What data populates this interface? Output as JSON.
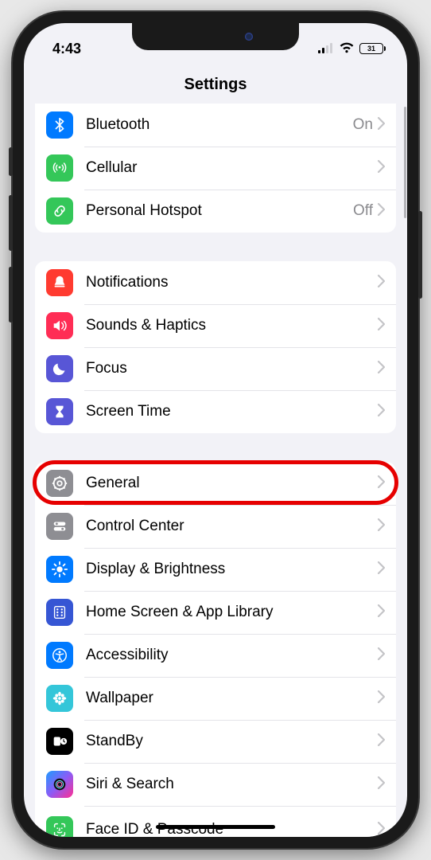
{
  "statusbar": {
    "time": "4:43",
    "battery_pct": "31"
  },
  "nav": {
    "title": "Settings"
  },
  "group0": {
    "bluetooth": {
      "label": "Bluetooth",
      "value": "On",
      "icon_color": "#007aff"
    },
    "cellular": {
      "label": "Cellular",
      "icon_color": "#34c759"
    },
    "hotspot": {
      "label": "Personal Hotspot",
      "value": "Off",
      "icon_color": "#34c759"
    }
  },
  "group1": {
    "notifications": {
      "label": "Notifications",
      "icon_color": "#ff3b30"
    },
    "sounds": {
      "label": "Sounds & Haptics",
      "icon_color": "#ff2d55"
    },
    "focus": {
      "label": "Focus",
      "icon_color": "#5856d6"
    },
    "screentime": {
      "label": "Screen Time",
      "icon_color": "#5856d6"
    }
  },
  "group2": {
    "general": {
      "label": "General",
      "icon_color": "#8e8e93"
    },
    "controlcenter": {
      "label": "Control Center",
      "icon_color": "#8e8e93"
    },
    "display": {
      "label": "Display & Brightness",
      "icon_color": "#007aff"
    },
    "homescreen": {
      "label": "Home Screen & App Library",
      "icon_color": "#3656d4"
    },
    "accessibility": {
      "label": "Accessibility",
      "icon_color": "#007aff"
    },
    "wallpaper": {
      "label": "Wallpaper",
      "icon_color": "#34c6d9"
    },
    "standby": {
      "label": "StandBy",
      "icon_color": "#000000"
    },
    "siri": {
      "label": "Siri & Search",
      "icon_color_a": "#1f9bff",
      "icon_color_b": "#ff2d92"
    },
    "faceid": {
      "label": "Face ID & Passcode",
      "icon_color": "#34c759"
    }
  },
  "annotation": {
    "highlighted_row": "general"
  }
}
